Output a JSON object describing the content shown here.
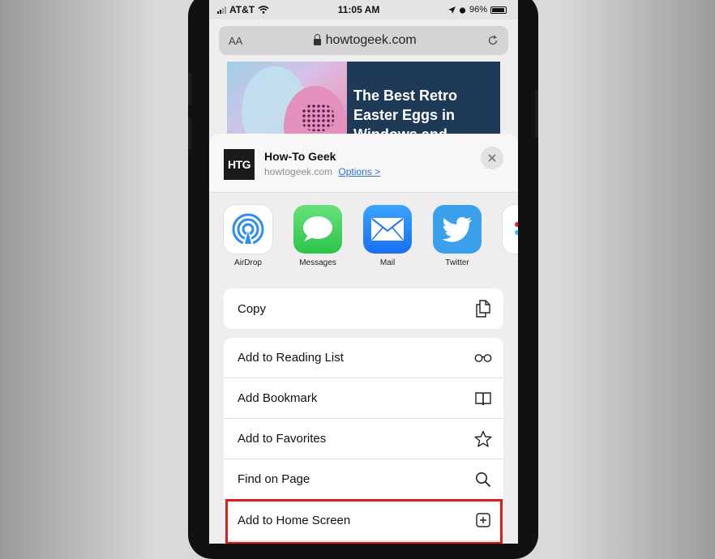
{
  "status": {
    "carrier": "AT&T",
    "time": "11:05 AM",
    "battery": "96%"
  },
  "browser": {
    "text_size_label": "AA",
    "url": "howtogeek.com"
  },
  "article": {
    "title": "The Best Retro Easter Eggs in Windows and"
  },
  "share_sheet": {
    "site_title": "How-To Geek",
    "site_url": "howtogeek.com",
    "options_label": "Options >",
    "logo_text": "HTG",
    "apps": [
      {
        "label": "AirDrop",
        "icon": "airdrop-icon"
      },
      {
        "label": "Messages",
        "icon": "messages-icon"
      },
      {
        "label": "Mail",
        "icon": "mail-icon"
      },
      {
        "label": "Twitter",
        "icon": "twitter-icon"
      }
    ],
    "actions_group1": [
      {
        "label": "Copy",
        "icon": "copy-icon"
      }
    ],
    "actions_group2": [
      {
        "label": "Add to Reading List",
        "icon": "glasses-icon"
      },
      {
        "label": "Add Bookmark",
        "icon": "book-icon"
      },
      {
        "label": "Add to Favorites",
        "icon": "star-icon"
      },
      {
        "label": "Find on Page",
        "icon": "search-icon"
      },
      {
        "label": "Add to Home Screen",
        "icon": "plus-square-icon"
      }
    ]
  },
  "colors": {
    "highlight": "#e01b1b",
    "link": "#2f6fd8",
    "article_bg": "#1f3a56"
  }
}
